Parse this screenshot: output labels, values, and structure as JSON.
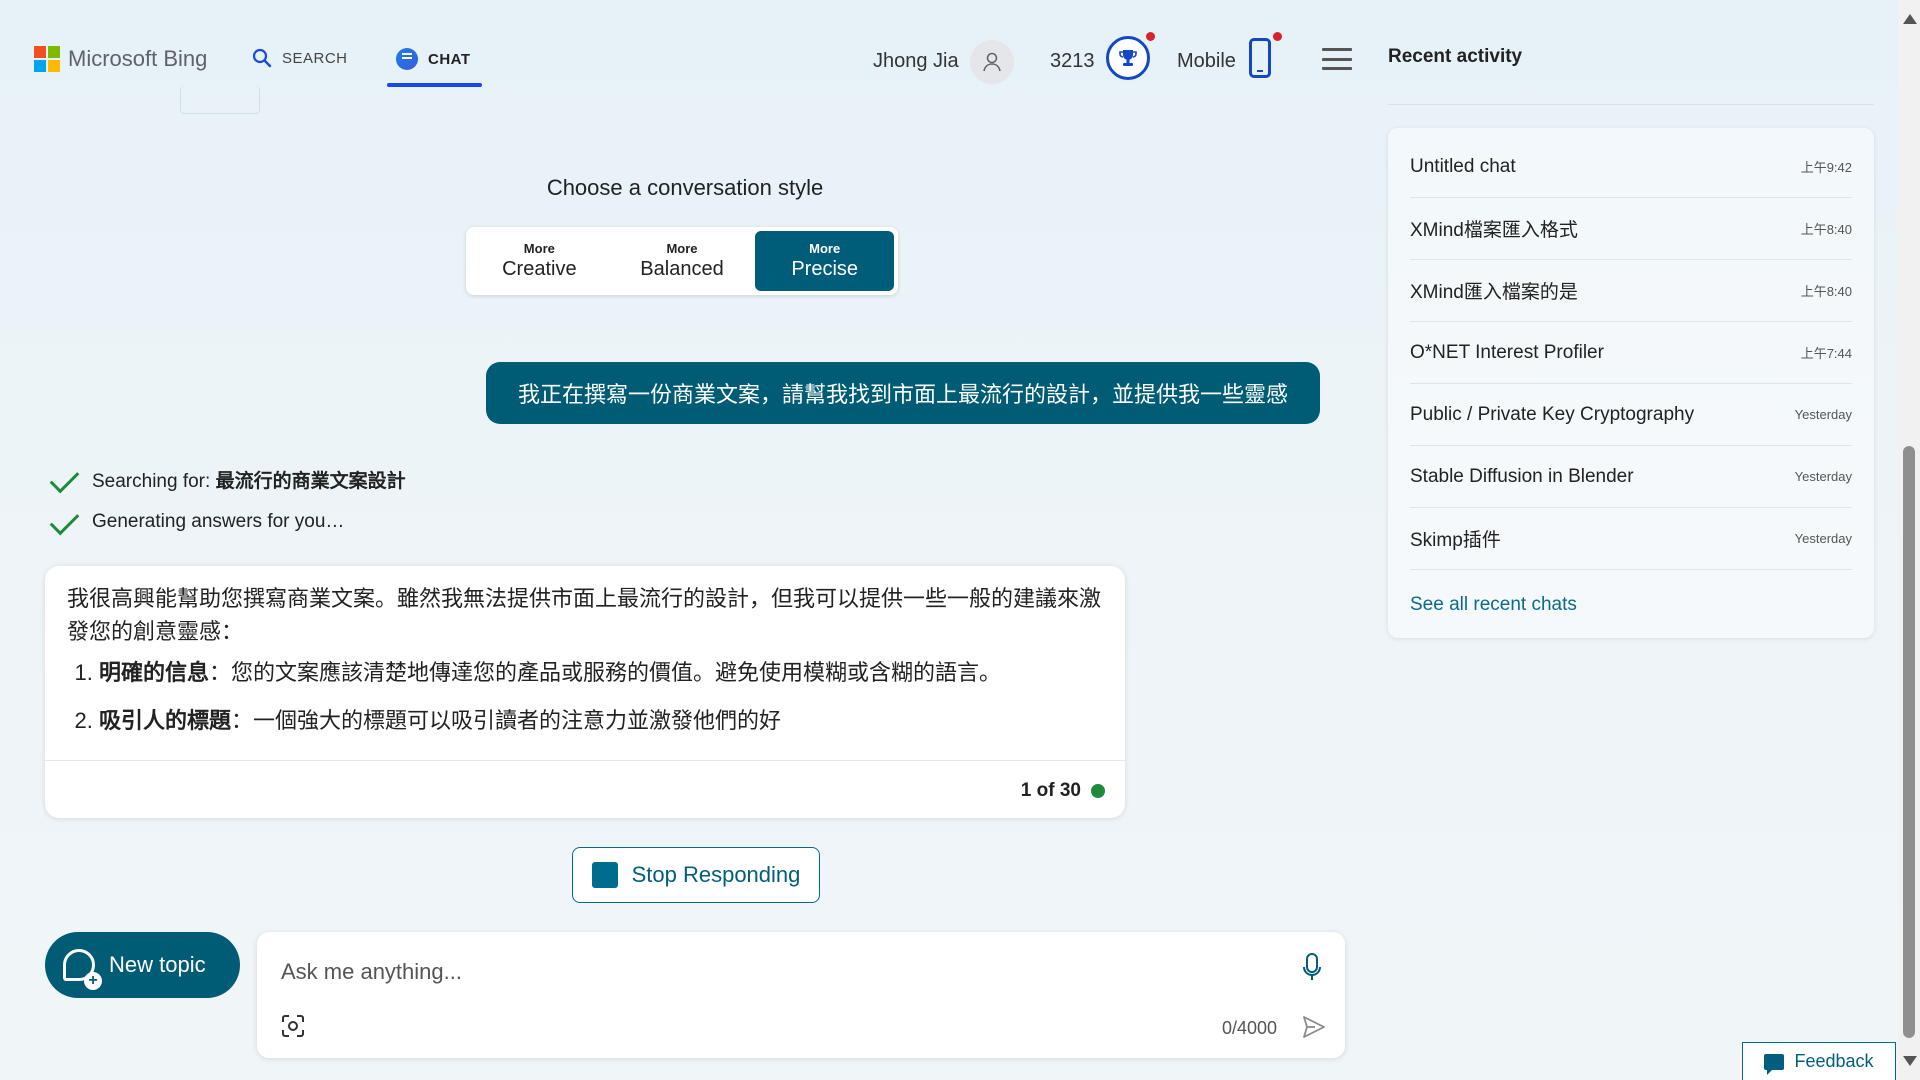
{
  "header": {
    "brand": "Microsoft Bing",
    "logo_colors": [
      "#f25022",
      "#7fba00",
      "#00a4ef",
      "#ffb900"
    ],
    "search_tab": "SEARCH",
    "chat_tab": "CHAT",
    "user_name": "Jhong Jia",
    "points": "3213",
    "mobile_label": "Mobile"
  },
  "conversation_style": {
    "title": "Choose a conversation style",
    "options": [
      {
        "line1": "More",
        "line2": "Creative",
        "selected": false
      },
      {
        "line1": "More",
        "line2": "Balanced",
        "selected": false
      },
      {
        "line1": "More",
        "line2": "Precise",
        "selected": true
      }
    ]
  },
  "chat": {
    "user_message": "我正在撰寫一份商業文案，請幫我找到市面上最流行的設計，並提供我一些靈感",
    "status": [
      {
        "prefix": "Searching for: ",
        "query": "最流行的商業文案設計"
      },
      {
        "prefix": "Generating answers for you…",
        "query": ""
      }
    ],
    "answer": {
      "intro": "我很高興能幫助您撰寫商業文案。雖然我無法提供市面上最流行的設計，但我可以提供一些一般的建議來激發您的創意靈感：",
      "items": [
        {
          "title": "明確的信息",
          "text": "：您的文案應該清楚地傳達您的產品或服務的價值。避免使用模糊或含糊的語言。"
        },
        {
          "title": "吸引人的標題",
          "text": "：一個強大的標題可以吸引讀者的注意力並激發他們的好"
        }
      ],
      "counter": "1 of 30"
    },
    "stop_label": "Stop Responding",
    "new_topic_label": "New topic",
    "input_placeholder": "Ask me anything...",
    "char_count": "0/4000"
  },
  "sidebar": {
    "title": "Recent activity",
    "items": [
      {
        "title": "Untitled chat",
        "time": "上午9:42"
      },
      {
        "title": "XMind檔案匯入格式",
        "time": "上午8:40"
      },
      {
        "title": "XMind匯入檔案的是",
        "time": "上午8:40"
      },
      {
        "title": "O*NET Interest Profiler",
        "time": "上午7:44"
      },
      {
        "title": "Public / Private Key Cryptography",
        "time": "Yesterday"
      },
      {
        "title": "Stable Diffusion in Blender",
        "time": "Yesterday"
      },
      {
        "title": "Skimp插件",
        "time": "Yesterday"
      }
    ],
    "see_all": "See all recent chats"
  },
  "feedback_label": "Feedback",
  "colors": {
    "accent": "#005b74",
    "brand_blue": "#1446c8",
    "success": "#1f8a3b",
    "notification": "#d8232a"
  }
}
